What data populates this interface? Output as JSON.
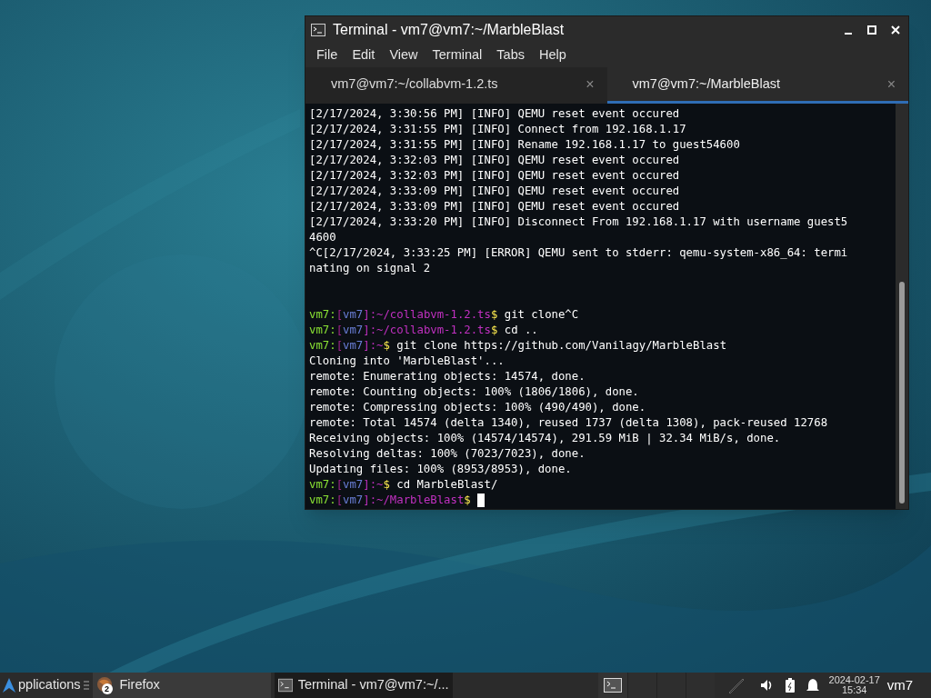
{
  "window": {
    "title": "Terminal - vm7@vm7:~/MarbleBlast"
  },
  "menu": [
    "File",
    "Edit",
    "View",
    "Terminal",
    "Tabs",
    "Help"
  ],
  "tabs": [
    {
      "label": "vm7@vm7:~/collabvm-1.2.ts",
      "close": "×",
      "selected": false
    },
    {
      "label": "vm7@vm7:~/MarbleBlast",
      "close": "×",
      "selected": true
    }
  ],
  "log": [
    "[2/17/2024, 3:30:56 PM] [INFO] QEMU reset event occured",
    "[2/17/2024, 3:31:55 PM] [INFO] Connect from 192.168.1.17",
    "[2/17/2024, 3:31:55 PM] [INFO] Rename 192.168.1.17 to guest54600",
    "[2/17/2024, 3:32:03 PM] [INFO] QEMU reset event occured",
    "[2/17/2024, 3:32:03 PM] [INFO] QEMU reset event occured",
    "[2/17/2024, 3:33:09 PM] [INFO] QEMU reset event occured",
    "[2/17/2024, 3:33:09 PM] [INFO] QEMU reset event occured",
    "[2/17/2024, 3:33:20 PM] [INFO] Disconnect From 192.168.1.17 with username guest5",
    "4600",
    "^C[2/17/2024, 3:33:25 PM] [ERROR] QEMU sent to stderr: qemu-system-x86_64: termi",
    "nating on signal 2"
  ],
  "session": [
    {
      "segments": [
        {
          "text": "vm7:",
          "color": "#8ae234"
        },
        {
          "text": "[",
          "color": "#a0208a"
        },
        {
          "text": "vm7",
          "color": "#6a7fd8"
        },
        {
          "text": "]:~/collabvm-1.2.ts",
          "color": "#c030c0"
        },
        {
          "text": "$",
          "color": "#fce94f"
        },
        {
          "text": " git clone^C",
          "color": "#ffffff"
        }
      ]
    },
    {
      "segments": [
        {
          "text": "vm7:",
          "color": "#8ae234"
        },
        {
          "text": "[",
          "color": "#a0208a"
        },
        {
          "text": "vm7",
          "color": "#6a7fd8"
        },
        {
          "text": "]:~/collabvm-1.2.ts",
          "color": "#c030c0"
        },
        {
          "text": "$",
          "color": "#fce94f"
        },
        {
          "text": " cd ..",
          "color": "#ffffff"
        }
      ]
    },
    {
      "segments": [
        {
          "text": "vm7:",
          "color": "#8ae234"
        },
        {
          "text": "[",
          "color": "#a0208a"
        },
        {
          "text": "vm7",
          "color": "#6a7fd8"
        },
        {
          "text": "]:~",
          "color": "#c030c0"
        },
        {
          "text": "$",
          "color": "#fce94f"
        },
        {
          "text": " git clone https://github.com/Vanilagy/MarbleBlast",
          "color": "#ffffff"
        }
      ]
    },
    {
      "segments": [
        {
          "text": "Cloning into 'MarbleBlast'...",
          "color": "#ffffff"
        }
      ]
    },
    {
      "segments": [
        {
          "text": "remote: Enumerating objects: 14574, done.",
          "color": "#ffffff"
        }
      ]
    },
    {
      "segments": [
        {
          "text": "remote: Counting objects: 100% (1806/1806), done.",
          "color": "#ffffff"
        }
      ]
    },
    {
      "segments": [
        {
          "text": "remote: Compressing objects: 100% (490/490), done.",
          "color": "#ffffff"
        }
      ]
    },
    {
      "segments": [
        {
          "text": "remote: Total 14574 (delta 1340), reused 1737 (delta 1308), pack-reused 12768",
          "color": "#ffffff"
        }
      ]
    },
    {
      "segments": [
        {
          "text": "Receiving objects: 100% (14574/14574), 291.59 MiB | 32.34 MiB/s, done.",
          "color": "#ffffff"
        }
      ]
    },
    {
      "segments": [
        {
          "text": "Resolving deltas: 100% (7023/7023), done.",
          "color": "#ffffff"
        }
      ]
    },
    {
      "segments": [
        {
          "text": "Updating files: 100% (8953/8953), done.",
          "color": "#ffffff"
        }
      ]
    },
    {
      "segments": [
        {
          "text": "vm7:",
          "color": "#8ae234"
        },
        {
          "text": "[",
          "color": "#a0208a"
        },
        {
          "text": "vm7",
          "color": "#6a7fd8"
        },
        {
          "text": "]:~",
          "color": "#c030c0"
        },
        {
          "text": "$",
          "color": "#fce94f"
        },
        {
          "text": " cd MarbleBlast/",
          "color": "#ffffff"
        }
      ]
    },
    {
      "segments": [
        {
          "text": "vm7:",
          "color": "#8ae234"
        },
        {
          "text": "[",
          "color": "#a0208a"
        },
        {
          "text": "vm7",
          "color": "#6a7fd8"
        },
        {
          "text": "]:~/MarbleBlast",
          "color": "#c030c0"
        },
        {
          "text": "$",
          "color": "#fce94f"
        }
      ],
      "cursor": true
    }
  ],
  "taskbar": {
    "apps_label": "pplications",
    "tasks": [
      {
        "label": "Firefox",
        "badge": "2",
        "kind": "firefox",
        "selected": false
      },
      {
        "label": "Terminal - vm7@vm7:~/...",
        "kind": "terminal",
        "selected": true
      }
    ],
    "date": "2024-02-17",
    "time": "15:34",
    "user": "vm7"
  }
}
